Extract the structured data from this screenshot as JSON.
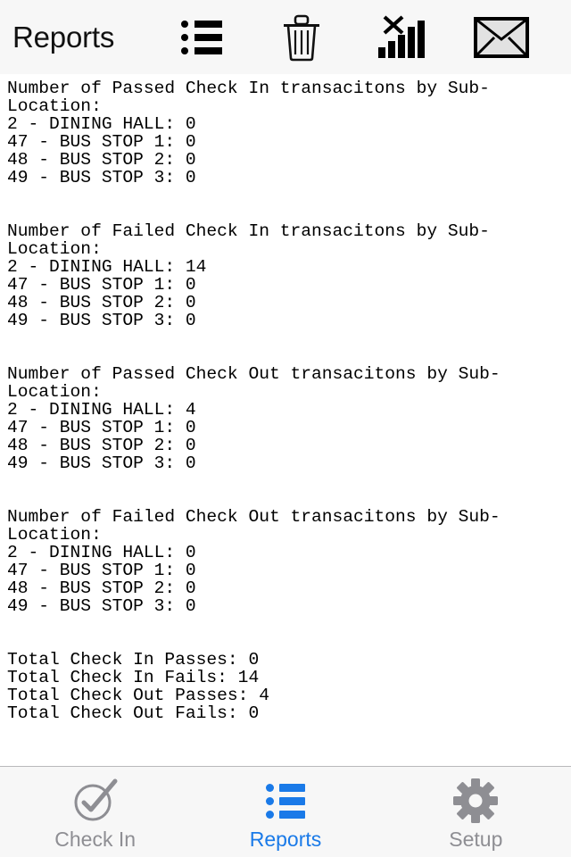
{
  "header": {
    "title": "Reports",
    "actions": [
      {
        "name": "list-icon",
        "label": "List"
      },
      {
        "name": "trash-icon",
        "label": "Delete"
      },
      {
        "name": "signal-off-icon",
        "label": "No Signal"
      },
      {
        "name": "envelope-icon",
        "label": "Email"
      }
    ]
  },
  "report": {
    "sections": [
      {
        "heading": "Number of Passed Check In transacitons by Sub-Location:",
        "rows": [
          {
            "label": "2 - DINING HALL",
            "value": "0"
          },
          {
            "label": "47 - BUS STOP 1",
            "value": "0"
          },
          {
            "label": "48 - BUS STOP 2",
            "value": "0"
          },
          {
            "label": "49 - BUS STOP 3",
            "value": "0"
          }
        ]
      },
      {
        "heading": "Number of Failed Check In transacitons by Sub-Location:",
        "rows": [
          {
            "label": "2 - DINING HALL",
            "value": "14"
          },
          {
            "label": "47 - BUS STOP 1",
            "value": "0"
          },
          {
            "label": "48 - BUS STOP 2",
            "value": "0"
          },
          {
            "label": "49 - BUS STOP 3",
            "value": "0"
          }
        ]
      },
      {
        "heading": "Number of Passed Check Out transacitons by Sub-Location:",
        "rows": [
          {
            "label": "2 - DINING HALL",
            "value": "4"
          },
          {
            "label": "47 - BUS STOP 1",
            "value": "0"
          },
          {
            "label": "48 - BUS STOP 2",
            "value": "0"
          },
          {
            "label": "49 - BUS STOP 3",
            "value": "0"
          }
        ]
      },
      {
        "heading": "Number of Failed Check Out transacitons by Sub-Location:",
        "rows": [
          {
            "label": "2 - DINING HALL",
            "value": "0"
          },
          {
            "label": "47 - BUS STOP 1",
            "value": "0"
          },
          {
            "label": "48 - BUS STOP 2",
            "value": "0"
          },
          {
            "label": "49 - BUS STOP 3",
            "value": "0"
          }
        ]
      }
    ],
    "totals": [
      {
        "label": "Total Check In Passes",
        "value": "0"
      },
      {
        "label": "Total Check In Fails",
        "value": "14"
      },
      {
        "label": "Total Check Out Passes",
        "value": "4"
      },
      {
        "label": "Total Check Out Fails",
        "value": "0"
      }
    ],
    "body_text": "Number of Passed Check In transacitons by Sub-Location:\n2 - DINING HALL: 0\n47 - BUS STOP 1: 0\n48 - BUS STOP 2: 0\n49 - BUS STOP 3: 0\n\n\nNumber of Failed Check In transacitons by Sub-Location:\n2 - DINING HALL: 14\n47 - BUS STOP 1: 0\n48 - BUS STOP 2: 0\n49 - BUS STOP 3: 0\n\n\nNumber of Passed Check Out transacitons by Sub-Location:\n2 - DINING HALL: 4\n47 - BUS STOP 1: 0\n48 - BUS STOP 2: 0\n49 - BUS STOP 3: 0\n\n\nNumber of Failed Check Out transacitons by Sub-Location:\n2 - DINING HALL: 0\n47 - BUS STOP 1: 0\n48 - BUS STOP 2: 0\n49 - BUS STOP 3: 0\n\n\nTotal Check In Passes: 0\nTotal Check In Fails: 14\nTotal Check Out Passes: 4\nTotal Check Out Fails: 0"
  },
  "tabbar": {
    "items": [
      {
        "label": "Check In",
        "icon": "check-circle-icon",
        "active": false
      },
      {
        "label": "Reports",
        "icon": "list-icon",
        "active": true
      },
      {
        "label": "Setup",
        "icon": "gear-icon",
        "active": false
      }
    ]
  },
  "colors": {
    "accent": "#1a7ae8",
    "inactive": "#8e8e93",
    "bar_background": "#f7f7f7",
    "content_background": "#ffffff",
    "text": "#000000"
  }
}
